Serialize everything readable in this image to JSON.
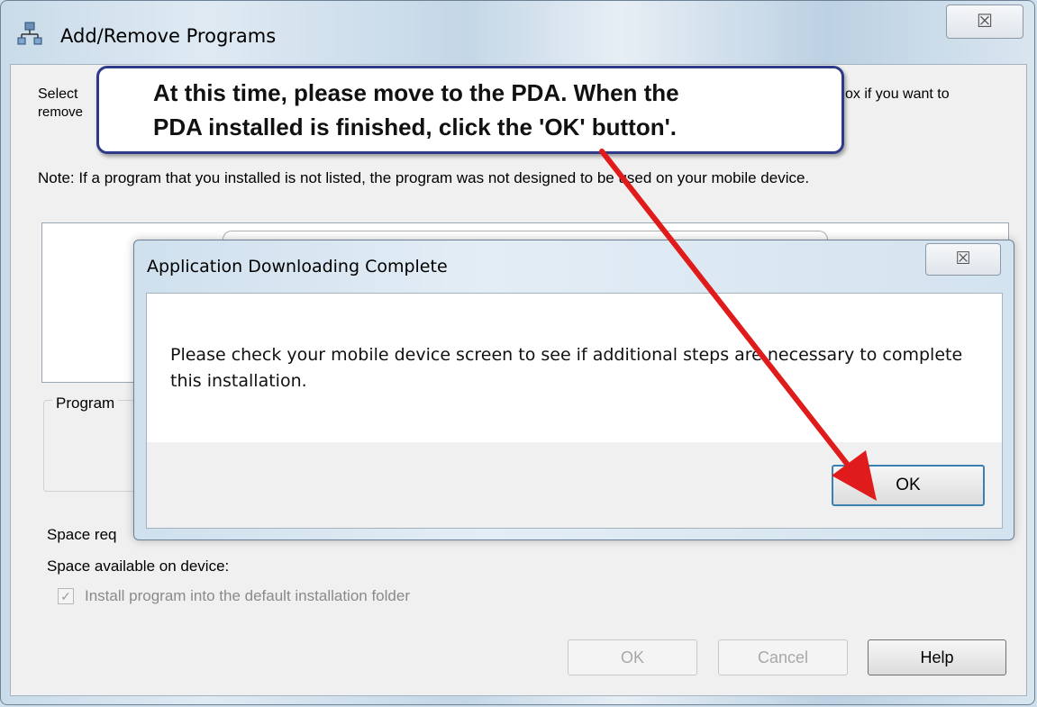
{
  "main_window": {
    "title": "Add/Remove Programs",
    "close_glyph": "☒",
    "instruction_left_1": "Select",
    "instruction_left_2": "remove",
    "instruction_right": "ox if you want to",
    "note": "Note:  If a program that you installed is not listed, the program was not designed to be used on your mobile device.",
    "group_label": "Program",
    "space_required_label": "Space req",
    "space_available_label": "Space available on device:",
    "install_default_label": "Install program into the default installation folder",
    "install_default_checked": true,
    "buttons": {
      "ok": "OK",
      "cancel": "Cancel",
      "help": "Help"
    }
  },
  "callout": {
    "line1": "At this time, please move to the PDA. When the",
    "line2": "PDA installed is finished, click the 'OK' button'.",
    "arrow_color": "#e01b1b"
  },
  "dialog": {
    "title": "Application Downloading Complete",
    "close_glyph": "☒",
    "message": "Please check your mobile device screen to see if additional steps are necessary to complete this installation.",
    "ok_label": "OK"
  }
}
